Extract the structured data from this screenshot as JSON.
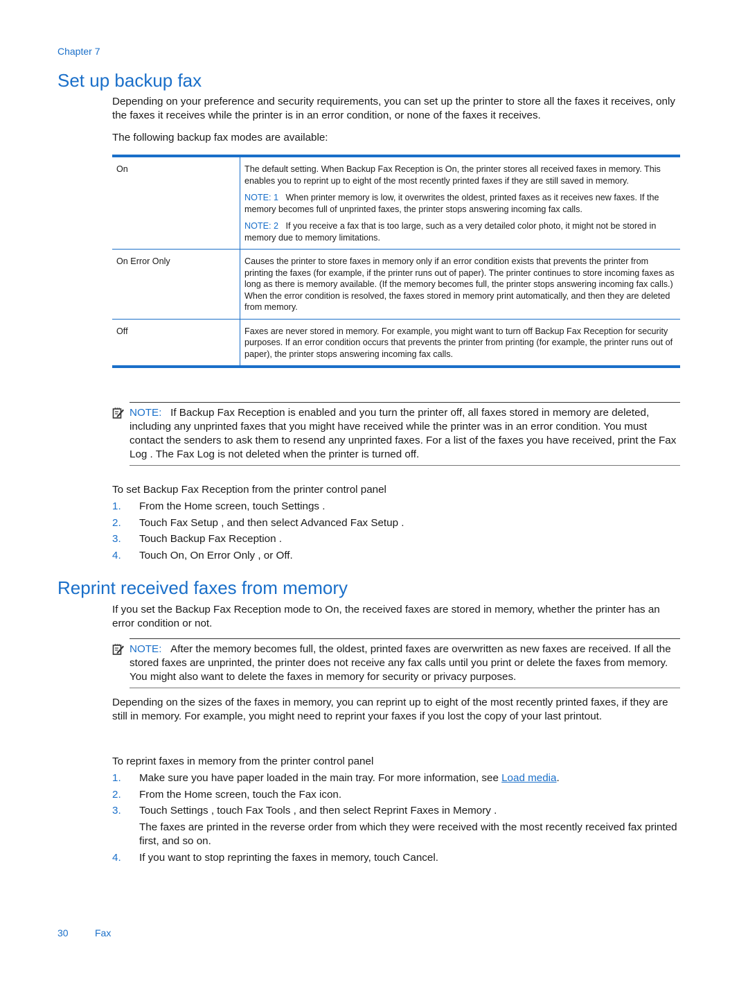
{
  "header": {
    "chapter": "Chapter 7"
  },
  "section1": {
    "title": "Set up backup fax",
    "intro": "Depending on your preference and security requirements, you can set up the printer to store all the faxes it receives, only the faxes it receives while the printer is in an error condition, or none of the faxes it receives.",
    "lead": "The following backup fax modes are available:",
    "modes": [
      {
        "mode": "On",
        "description": "The default setting. When Backup Fax Reception   is On, the printer stores all received faxes in memory. This enables you to reprint up to eight of the most recently printed faxes if they are still saved in memory.",
        "notes": [
          {
            "label": "NOTE: 1",
            "text": "When printer memory is low, it overwrites the oldest, printed faxes as it receives new faxes. If the memory becomes full of unprinted faxes, the printer stops answering incoming fax calls."
          },
          {
            "label": "NOTE: 2",
            "text": "If you receive a fax that is too large, such as a very detailed color photo, it might not be stored in memory due to memory limitations."
          }
        ]
      },
      {
        "mode": "On Error Only",
        "description": "Causes the printer to store faxes in memory only if an error condition exists that prevents the printer from printing the faxes (for example, if the printer runs out of paper). The printer continues to store incoming faxes as long as there is memory available. (If the memory becomes full, the printer stops answering incoming fax calls.) When the error condition is resolved, the faxes stored in memory print automatically, and then they are deleted from memory."
      },
      {
        "mode": "Off",
        "description": "Faxes are never stored in memory. For example, you might want to turn off Backup Fax Reception  for security purposes. If an error condition occurs that prevents the printer from printing (for example, the printer runs out of paper), the printer stops answering incoming fax calls."
      }
    ],
    "note": {
      "label": "NOTE:",
      "text": "If Backup Fax Reception   is enabled and you turn the printer off, all faxes stored in memory are deleted, including any unprinted faxes that you might have received while the printer was in an error condition. You must contact the senders to ask them to resend any unprinted faxes. For a list of the faxes you have received, print the Fax Log . The Fax Log  is not deleted when the printer is turned off."
    },
    "procedure_title": "To set Backup Fax Reception from the printer control panel",
    "steps": [
      {
        "num": "1.",
        "text": "From the Home screen, touch Settings ."
      },
      {
        "num": "2.",
        "text": "Touch Fax Setup , and then select Advanced Fax Setup  ."
      },
      {
        "num": "3.",
        "text": "Touch Backup Fax Reception   ."
      },
      {
        "num": "4.",
        "text": "Touch On, On Error Only  , or Off."
      }
    ]
  },
  "section2": {
    "title": "Reprint received faxes from memory",
    "intro": "If you set the Backup Fax Reception   mode to On, the received faxes are stored in memory, whether the printer has an error condition or not.",
    "note": {
      "label": "NOTE:",
      "text": "After the memory becomes full, the oldest, printed faxes are overwritten as new faxes are received. If all the stored faxes are unprinted, the printer does not receive any fax calls until you print or delete the faxes from memory. You might also want to delete the faxes in memory for security or privacy purposes."
    },
    "body": "Depending on the sizes of the faxes in memory, you can reprint up to eight of the most recently printed faxes, if they are still in memory. For example, you might need to reprint your faxes if you lost the copy of your last printout.",
    "procedure_title": "To reprint faxes in memory from the printer control panel",
    "steps": [
      {
        "num": "1.",
        "text": "Make sure you have paper loaded in the main tray. For more information, see ",
        "link": "Load media",
        "after": "."
      },
      {
        "num": "2.",
        "text": "From the Home screen, touch the Fax icon."
      },
      {
        "num": "3.",
        "text": "Touch Settings , touch Fax Tools , and then select Reprint Faxes in Memory   .",
        "sub": "The faxes are printed in the reverse order from which they were received with the most recently received fax printed first, and so on."
      },
      {
        "num": "4.",
        "text": "If you want to stop reprinting the faxes in memory, touch Cancel."
      }
    ]
  },
  "footer": {
    "page_number": "30",
    "section": "Fax"
  },
  "colors": {
    "accent": "#1a6fc9",
    "text": "#1a1a1a"
  }
}
